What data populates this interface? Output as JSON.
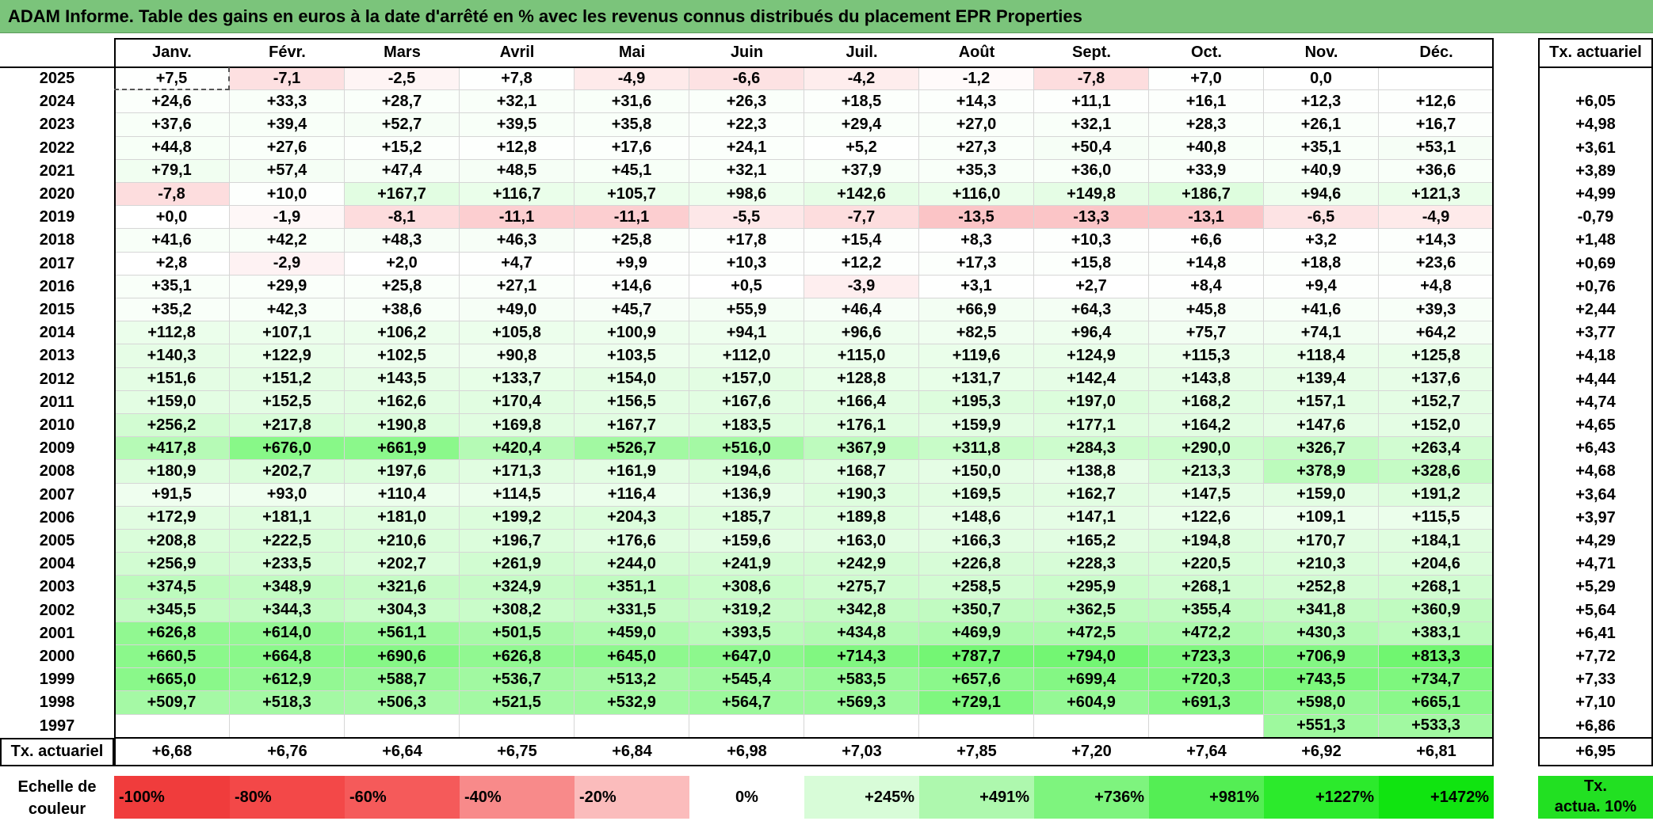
{
  "title": "ADAM Informe. Table des gains en euros à la date d'arrêté en % avec les revenus connus distribués du placement EPR Properties",
  "months": [
    "Janv.",
    "Févr.",
    "Mars",
    "Avril",
    "Mai",
    "Juin",
    "Juil.",
    "Août",
    "Sept.",
    "Oct.",
    "Nov.",
    "Déc."
  ],
  "actuarial_header": "Tx. actuariel",
  "footer_label": "Tx. actuariel",
  "rows": [
    {
      "year": "2025",
      "values": [
        "+7,5",
        "-7,1",
        "-2,5",
        "+7,8",
        "-4,9",
        "-6,6",
        "-4,2",
        "-1,2",
        "-7,8",
        "+7,0",
        "0,0",
        ""
      ],
      "rate": ""
    },
    {
      "year": "2024",
      "values": [
        "+24,6",
        "+33,3",
        "+28,7",
        "+32,1",
        "+31,6",
        "+26,3",
        "+18,5",
        "+14,3",
        "+11,1",
        "+16,1",
        "+12,3",
        "+12,6"
      ],
      "rate": "+6,05"
    },
    {
      "year": "2023",
      "values": [
        "+37,6",
        "+39,4",
        "+52,7",
        "+39,5",
        "+35,8",
        "+22,3",
        "+29,4",
        "+27,0",
        "+32,1",
        "+28,3",
        "+26,1",
        "+16,7"
      ],
      "rate": "+4,98"
    },
    {
      "year": "2022",
      "values": [
        "+44,8",
        "+27,6",
        "+15,2",
        "+12,8",
        "+17,6",
        "+24,1",
        "+5,2",
        "+27,3",
        "+50,4",
        "+40,8",
        "+35,1",
        "+53,1"
      ],
      "rate": "+3,61"
    },
    {
      "year": "2021",
      "values": [
        "+79,1",
        "+57,4",
        "+47,4",
        "+48,5",
        "+45,1",
        "+32,1",
        "+37,9",
        "+35,3",
        "+36,0",
        "+33,9",
        "+40,9",
        "+36,6"
      ],
      "rate": "+3,89"
    },
    {
      "year": "2020",
      "values": [
        "-7,8",
        "+10,0",
        "+167,7",
        "+116,7",
        "+105,7",
        "+98,6",
        "+142,6",
        "+116,0",
        "+149,8",
        "+186,7",
        "+94,6",
        "+121,3"
      ],
      "rate": "+4,99"
    },
    {
      "year": "2019",
      "values": [
        "+0,0",
        "-1,9",
        "-8,1",
        "-11,1",
        "-11,1",
        "-5,5",
        "-7,7",
        "-13,5",
        "-13,3",
        "-13,1",
        "-6,5",
        "-4,9"
      ],
      "rate": "-0,79"
    },
    {
      "year": "2018",
      "values": [
        "+41,6",
        "+42,2",
        "+48,3",
        "+46,3",
        "+25,8",
        "+17,8",
        "+15,4",
        "+8,3",
        "+10,3",
        "+6,6",
        "+3,2",
        "+14,3"
      ],
      "rate": "+1,48"
    },
    {
      "year": "2017",
      "values": [
        "+2,8",
        "-2,9",
        "+2,0",
        "+4,7",
        "+9,9",
        "+10,3",
        "+12,2",
        "+17,3",
        "+15,8",
        "+14,8",
        "+18,8",
        "+23,6"
      ],
      "rate": "+0,69"
    },
    {
      "year": "2016",
      "values": [
        "+35,1",
        "+29,9",
        "+25,8",
        "+27,1",
        "+14,6",
        "+0,5",
        "-3,9",
        "+3,1",
        "+2,7",
        "+8,4",
        "+9,4",
        "+4,8"
      ],
      "rate": "+0,76"
    },
    {
      "year": "2015",
      "values": [
        "+35,2",
        "+42,3",
        "+38,6",
        "+49,0",
        "+45,7",
        "+55,9",
        "+46,4",
        "+66,9",
        "+64,3",
        "+45,8",
        "+41,6",
        "+39,3"
      ],
      "rate": "+2,44"
    },
    {
      "year": "2014",
      "values": [
        "+112,8",
        "+107,1",
        "+106,2",
        "+105,8",
        "+100,9",
        "+94,1",
        "+96,6",
        "+82,5",
        "+96,4",
        "+75,7",
        "+74,1",
        "+64,2"
      ],
      "rate": "+3,77"
    },
    {
      "year": "2013",
      "values": [
        "+140,3",
        "+122,9",
        "+102,5",
        "+90,8",
        "+103,5",
        "+112,0",
        "+115,0",
        "+119,6",
        "+124,9",
        "+115,3",
        "+118,4",
        "+125,8"
      ],
      "rate": "+4,18"
    },
    {
      "year": "2012",
      "values": [
        "+151,6",
        "+151,2",
        "+143,5",
        "+133,7",
        "+154,0",
        "+157,0",
        "+128,8",
        "+131,7",
        "+142,4",
        "+143,8",
        "+139,4",
        "+137,6"
      ],
      "rate": "+4,44"
    },
    {
      "year": "2011",
      "values": [
        "+159,0",
        "+152,5",
        "+162,6",
        "+170,4",
        "+156,5",
        "+167,6",
        "+166,4",
        "+195,3",
        "+197,0",
        "+168,2",
        "+157,1",
        "+152,7"
      ],
      "rate": "+4,74"
    },
    {
      "year": "2010",
      "values": [
        "+256,2",
        "+217,8",
        "+190,8",
        "+169,8",
        "+167,7",
        "+183,5",
        "+176,1",
        "+159,9",
        "+177,1",
        "+164,2",
        "+147,6",
        "+152,0"
      ],
      "rate": "+4,65"
    },
    {
      "year": "2009",
      "values": [
        "+417,8",
        "+676,0",
        "+661,9",
        "+420,4",
        "+526,7",
        "+516,0",
        "+367,9",
        "+311,8",
        "+284,3",
        "+290,0",
        "+326,7",
        "+263,4"
      ],
      "rate": "+6,43"
    },
    {
      "year": "2008",
      "values": [
        "+180,9",
        "+202,7",
        "+197,6",
        "+171,3",
        "+161,9",
        "+194,6",
        "+168,7",
        "+150,0",
        "+138,8",
        "+213,3",
        "+378,9",
        "+328,6"
      ],
      "rate": "+4,68"
    },
    {
      "year": "2007",
      "values": [
        "+91,5",
        "+93,0",
        "+110,4",
        "+114,5",
        "+116,4",
        "+136,9",
        "+190,3",
        "+169,5",
        "+162,7",
        "+147,5",
        "+159,0",
        "+191,2"
      ],
      "rate": "+3,64"
    },
    {
      "year": "2006",
      "values": [
        "+172,9",
        "+181,1",
        "+181,0",
        "+199,2",
        "+204,3",
        "+185,7",
        "+189,8",
        "+148,6",
        "+147,1",
        "+122,6",
        "+109,1",
        "+115,5"
      ],
      "rate": "+3,97"
    },
    {
      "year": "2005",
      "values": [
        "+208,8",
        "+222,5",
        "+210,6",
        "+196,7",
        "+176,6",
        "+159,6",
        "+163,0",
        "+166,3",
        "+165,2",
        "+194,8",
        "+170,7",
        "+184,1"
      ],
      "rate": "+4,29"
    },
    {
      "year": "2004",
      "values": [
        "+256,9",
        "+233,5",
        "+202,7",
        "+261,9",
        "+244,0",
        "+241,9",
        "+242,9",
        "+226,8",
        "+228,3",
        "+220,5",
        "+210,3",
        "+204,6"
      ],
      "rate": "+4,71"
    },
    {
      "year": "2003",
      "values": [
        "+374,5",
        "+348,9",
        "+321,6",
        "+324,9",
        "+351,1",
        "+308,6",
        "+275,7",
        "+258,5",
        "+295,9",
        "+268,1",
        "+252,8",
        "+268,1"
      ],
      "rate": "+5,29"
    },
    {
      "year": "2002",
      "values": [
        "+345,5",
        "+344,3",
        "+304,3",
        "+308,2",
        "+331,5",
        "+319,2",
        "+342,8",
        "+350,7",
        "+362,5",
        "+355,4",
        "+341,8",
        "+360,9"
      ],
      "rate": "+5,64"
    },
    {
      "year": "2001",
      "values": [
        "+626,8",
        "+614,0",
        "+561,1",
        "+501,5",
        "+459,0",
        "+393,5",
        "+434,8",
        "+469,9",
        "+472,5",
        "+472,2",
        "+430,3",
        "+383,1"
      ],
      "rate": "+6,41"
    },
    {
      "year": "2000",
      "values": [
        "+660,5",
        "+664,8",
        "+690,6",
        "+626,8",
        "+645,0",
        "+647,0",
        "+714,3",
        "+787,7",
        "+794,0",
        "+723,3",
        "+706,9",
        "+813,3"
      ],
      "rate": "+7,72"
    },
    {
      "year": "1999",
      "values": [
        "+665,0",
        "+612,9",
        "+588,7",
        "+536,7",
        "+513,2",
        "+545,4",
        "+583,5",
        "+657,6",
        "+699,4",
        "+720,3",
        "+743,5",
        "+734,7"
      ],
      "rate": "+7,33"
    },
    {
      "year": "1998",
      "values": [
        "+509,7",
        "+518,3",
        "+506,3",
        "+521,5",
        "+532,9",
        "+564,7",
        "+569,3",
        "+729,1",
        "+604,9",
        "+691,3",
        "+598,0",
        "+665,1"
      ],
      "rate": "+7,10"
    },
    {
      "year": "1997",
      "values": [
        "",
        "",
        "",
        "",
        "",
        "",
        "",
        "",
        "",
        "",
        "+551,3",
        "+533,3"
      ],
      "rate": "+6,86"
    }
  ],
  "footer_values": [
    "+6,68",
    "+6,76",
    "+6,64",
    "+6,75",
    "+6,84",
    "+6,98",
    "+7,03",
    "+7,85",
    "+7,20",
    "+7,64",
    "+6,92",
    "+6,81"
  ],
  "footer_rate": "+6,95",
  "legend": {
    "label_line1": "Echelle de",
    "label_line2": "couleur",
    "cells": [
      {
        "text": "-100%",
        "color": "#f03c3c"
      },
      {
        "text": "-80%",
        "color": "#f34848"
      },
      {
        "text": "-60%",
        "color": "#f55a5a"
      },
      {
        "text": "-40%",
        "color": "#f88a8a"
      },
      {
        "text": "-20%",
        "color": "#fbbcbc"
      },
      {
        "text": "0%",
        "color": "#ffffff"
      },
      {
        "text": "+245%",
        "color": "#d8fcd8"
      },
      {
        "text": "+491%",
        "color": "#aef8ae"
      },
      {
        "text": "+736%",
        "color": "#7ef47e"
      },
      {
        "text": "+981%",
        "color": "#54ee54"
      },
      {
        "text": "+1227%",
        "color": "#2cea2c"
      },
      {
        "text": "+1472%",
        "color": "#10e410"
      }
    ],
    "rate_line1": "Tx.",
    "rate_line2": "actua. 10%",
    "rate_color": "#22e022"
  }
}
